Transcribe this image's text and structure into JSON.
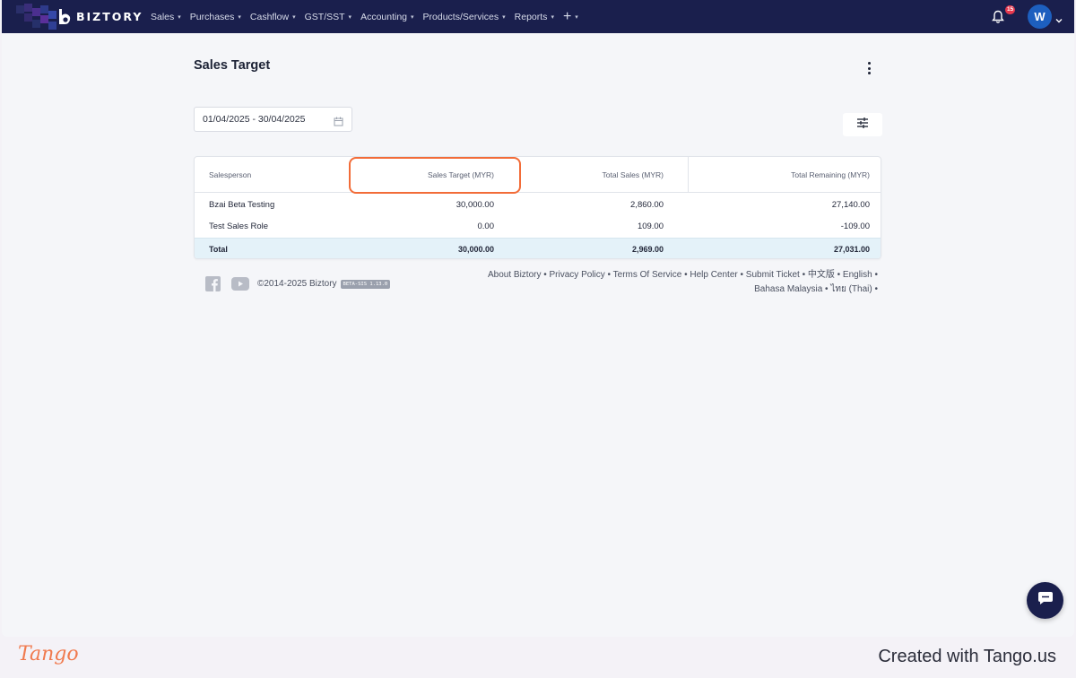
{
  "nav": {
    "brand": "BIZTORY",
    "menu": [
      {
        "label": "Sales"
      },
      {
        "label": "Purchases"
      },
      {
        "label": "Cashflow"
      },
      {
        "label": "GST/SST"
      },
      {
        "label": "Accounting"
      },
      {
        "label": "Products/Services"
      },
      {
        "label": "Reports"
      }
    ],
    "plus_label": "+",
    "notification_count": "15",
    "avatar_initial": "W"
  },
  "page": {
    "title": "Sales Target",
    "date_range": "01/04/2025 - 30/04/2025"
  },
  "table": {
    "headers": [
      "Salesperson",
      "Sales Target (MYR)",
      "Total Sales (MYR)",
      "Total Remaining (MYR)"
    ],
    "rows": [
      [
        "Bzai Beta Testing",
        "30,000.00",
        "2,860.00",
        "27,140.00"
      ],
      [
        "Test Sales Role",
        "0.00",
        "109.00",
        "-109.00"
      ]
    ],
    "total": [
      "Total",
      "30,000.00",
      "2,969.00",
      "27,031.00"
    ]
  },
  "footer": {
    "copyright": "©2014-2025 Biztory",
    "version_badge": "BETA-SIS 1.13.0",
    "links_line1": "About Biztory • Privacy Policy • Terms Of Service • Help Center • Submit Ticket • 中文版 • English •",
    "links_line2": "Bahasa Malaysia • ไทย (Thai) •"
  },
  "tango": {
    "logo": "Tango",
    "created": "Created with Tango.us"
  },
  "colors": {
    "nav_bg": "#1a1f4d",
    "highlight": "#f26c38",
    "total_row_bg": "#e4f2f9",
    "badge": "#e6394f",
    "avatar": "#1d5fbf"
  }
}
